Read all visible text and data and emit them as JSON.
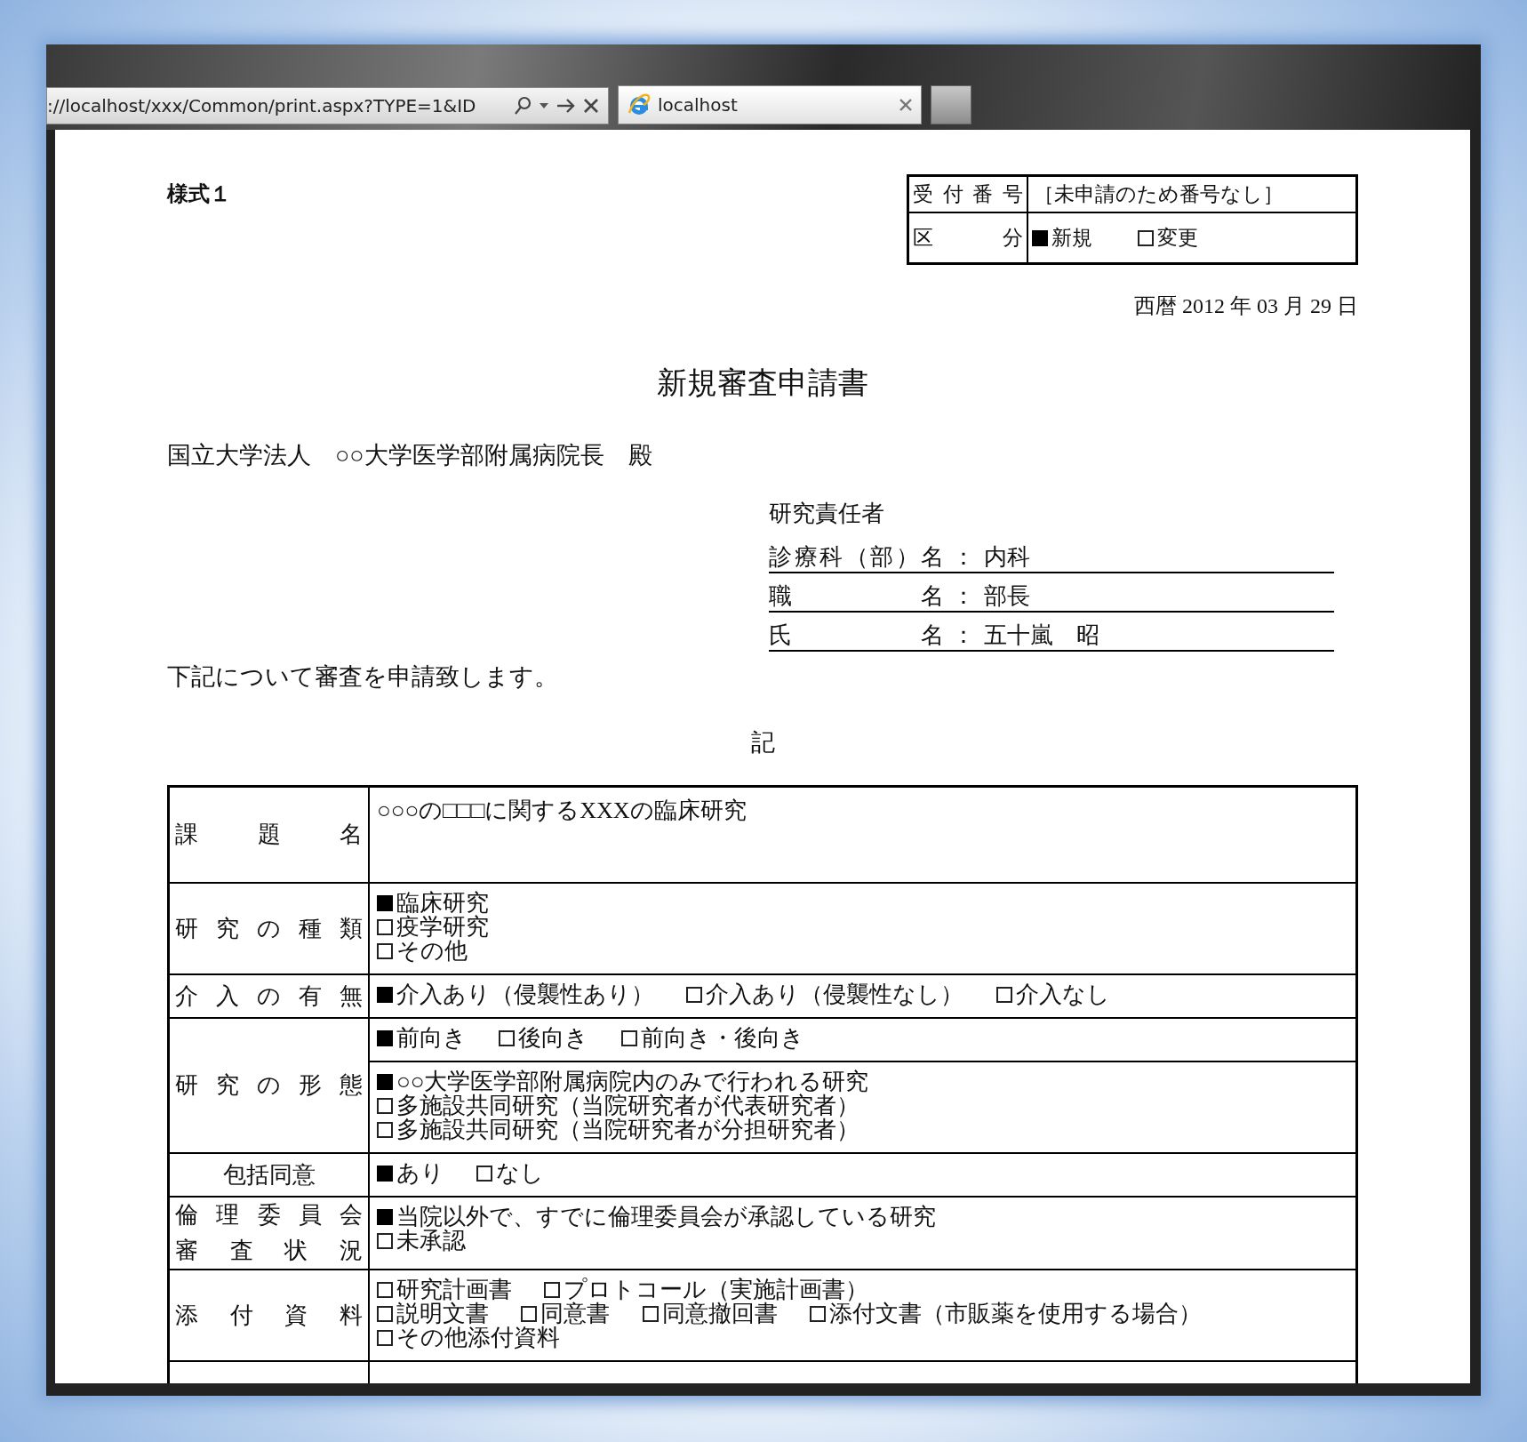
{
  "browser": {
    "address": "://localhost/xxx/Common/print.aspx?TYPE=1&ID",
    "tabs": [
      {
        "title": "localhost",
        "selected": true
      }
    ]
  },
  "document": {
    "form_no": "様式１",
    "receipt": [
      {
        "label": "受付番号",
        "kind": "text",
        "text": "［未申請のため番号なし］"
      },
      {
        "label": "区分",
        "kind": "options",
        "options": [
          {
            "label": "新規",
            "checked": true
          },
          {
            "label": "変更",
            "checked": false
          }
        ]
      }
    ],
    "date": "西暦 2012 年 03 月 29 日",
    "title": "新規審査申請書",
    "addressee": "国立大学法人　○○大学医学部附属病院長　殿",
    "researcher": {
      "heading": "研究責任者",
      "rows": [
        {
          "label": "診療科（部）名",
          "sep": "：",
          "value": "内科"
        },
        {
          "label": "職名",
          "sep": "：",
          "value": "部長"
        },
        {
          "label": "氏名",
          "sep": "：",
          "value": "五十嵐　昭"
        }
      ]
    },
    "request": "下記について審査を申請致します。",
    "note_heading": "記",
    "table": [
      {
        "label_lines": [
          "課題名"
        ],
        "centered": false,
        "blocks": [
          {
            "kind": "text",
            "text": "○○○の□□□に関するXXXの臨床研究"
          }
        ]
      },
      {
        "label_lines": [
          "研究の種類"
        ],
        "centered": false,
        "blocks": [
          {
            "kind": "options",
            "lines": [
              [
                {
                  "label": "臨床研究",
                  "checked": true
                }
              ],
              [
                {
                  "label": "疫学研究",
                  "checked": false
                }
              ],
              [
                {
                  "label": "その他",
                  "checked": false
                }
              ]
            ]
          }
        ]
      },
      {
        "label_lines": [
          "介入の有無"
        ],
        "centered": false,
        "blocks": [
          {
            "kind": "options",
            "lines": [
              [
                {
                  "label": "介入あり（侵襲性あり）",
                  "checked": true
                },
                {
                  "label": "介入あり（侵襲性なし）",
                  "checked": false
                },
                {
                  "label": "介入なし",
                  "checked": false
                }
              ]
            ]
          }
        ]
      },
      {
        "label_lines": [
          "研究の形態"
        ],
        "centered": false,
        "blocks": [
          {
            "kind": "options",
            "lines": [
              [
                {
                  "label": "前向き",
                  "checked": true
                },
                {
                  "label": "後向き",
                  "checked": false
                },
                {
                  "label": "前向き・後向き",
                  "checked": false
                }
              ]
            ]
          },
          {
            "kind": "options",
            "lines": [
              [
                {
                  "label": "○○大学医学部附属病院内のみで行われる研究",
                  "checked": true
                }
              ],
              [
                {
                  "label": "多施設共同研究（当院研究者が代表研究者）",
                  "checked": false
                }
              ],
              [
                {
                  "label": "多施設共同研究（当院研究者が分担研究者）",
                  "checked": false
                }
              ]
            ]
          }
        ]
      },
      {
        "label_lines": [
          "包括同意"
        ],
        "centered": true,
        "blocks": [
          {
            "kind": "options",
            "lines": [
              [
                {
                  "label": "あり",
                  "checked": true
                },
                {
                  "label": "なし",
                  "checked": false
                }
              ]
            ]
          }
        ]
      },
      {
        "label_lines": [
          "倫理委員会",
          "審査状況"
        ],
        "centered": false,
        "blocks": [
          {
            "kind": "options",
            "lines": [
              [
                {
                  "label": "当院以外で、すでに倫理委員会が承認している研究",
                  "checked": true
                }
              ],
              [
                {
                  "label": "未承認",
                  "checked": false
                }
              ]
            ]
          }
        ]
      },
      {
        "label_lines": [
          "添付資料"
        ],
        "centered": false,
        "blocks": [
          {
            "kind": "options",
            "lines": [
              [
                {
                  "label": "研究計画書",
                  "checked": false
                },
                {
                  "label": "プロトコール（実施計画書）",
                  "checked": false
                }
              ],
              [
                {
                  "label": "説明文書",
                  "checked": false
                },
                {
                  "label": "同意書",
                  "checked": false
                },
                {
                  "label": "同意撤回書",
                  "checked": false
                },
                {
                  "label": "添付文書（市販薬を使用する場合）",
                  "checked": false
                }
              ],
              [
                {
                  "label": "その他添付資料",
                  "checked": false
                }
              ]
            ]
          }
        ]
      }
    ]
  }
}
